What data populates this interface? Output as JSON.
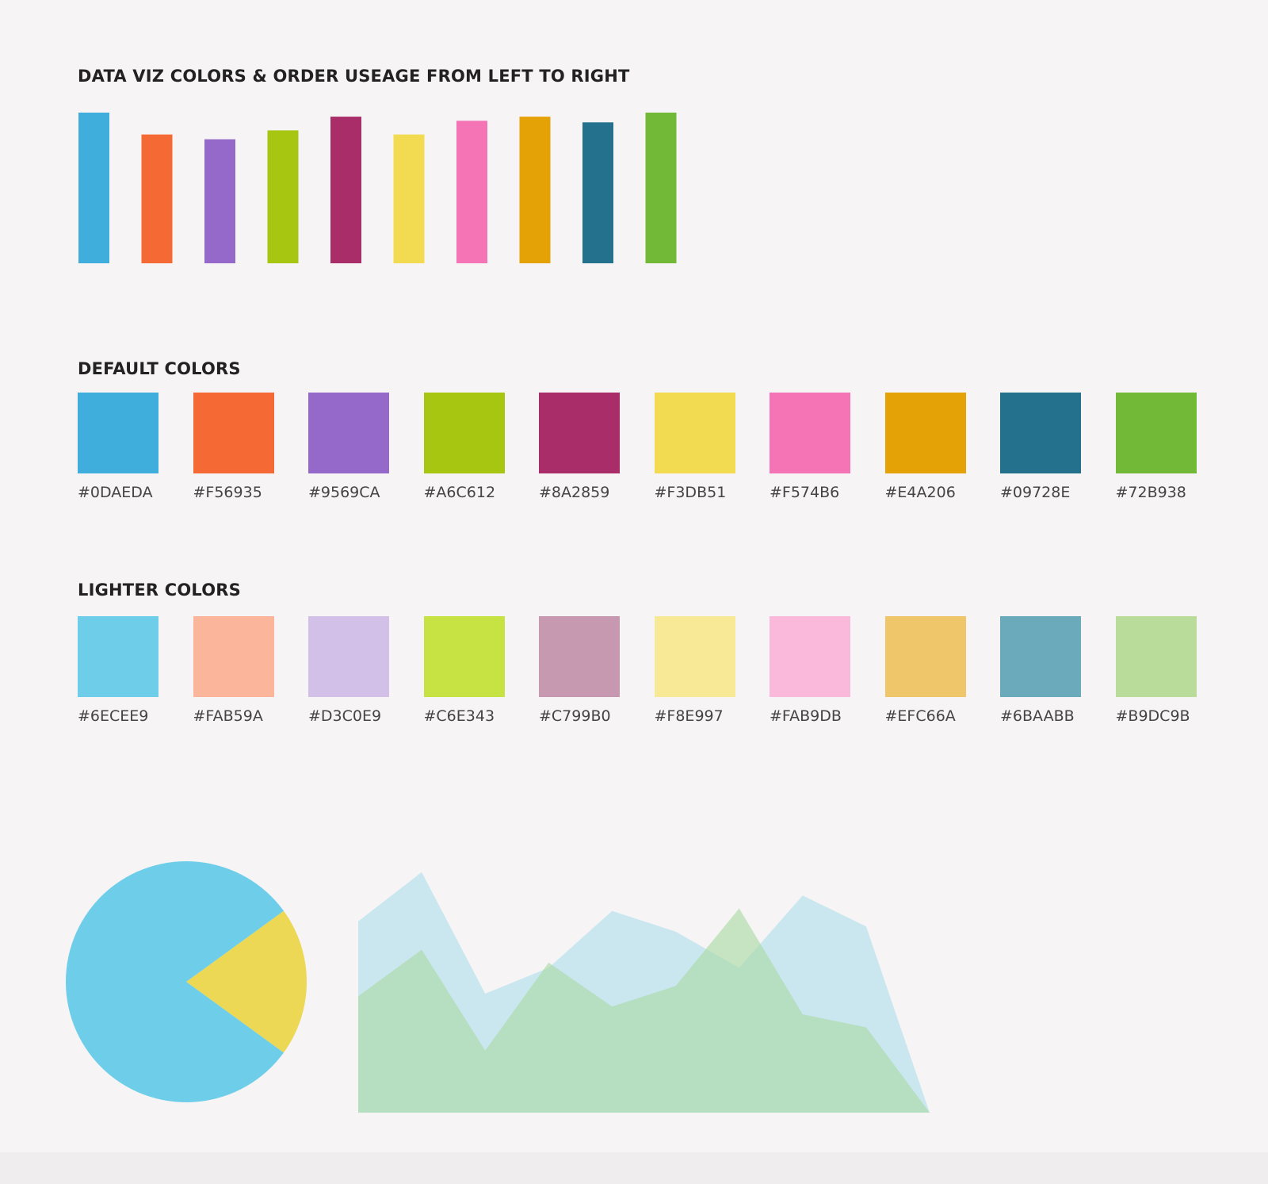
{
  "sections": {
    "order_title": "DATA VIZ COLORS & ORDER USEAGE FROM LEFT TO RIGHT",
    "default_title": "DEFAULT COLORS",
    "lighter_title": "LIGHTER COLORS"
  },
  "default_colors": [
    {
      "label": "#0DAEDA",
      "color": "#40AEDC"
    },
    {
      "label": "#F56935",
      "color": "#F56935"
    },
    {
      "label": "#9569CA",
      "color": "#9569CA"
    },
    {
      "label": "#A6C612",
      "color": "#A6C612"
    },
    {
      "label": "#8A2859",
      "color": "#A82D69"
    },
    {
      "label": "#F3DB51",
      "color": "#F3DB51"
    },
    {
      "label": "#F574B6",
      "color": "#F574B6"
    },
    {
      "label": "#E4A206",
      "color": "#E4A206"
    },
    {
      "label": "#09728E",
      "color": "#24718E"
    },
    {
      "label": "#72B938",
      "color": "#72B938"
    }
  ],
  "lighter_colors": [
    {
      "label": "#6ECEE9",
      "color": "#6ECEE9"
    },
    {
      "label": "#FAB59A",
      "color": "#FAB59A"
    },
    {
      "label": "#D3C0E9",
      "color": "#D3C0E9"
    },
    {
      "label": "#C6E343",
      "color": "#C6E343"
    },
    {
      "label": "#C799B0",
      "color": "#C799B0"
    },
    {
      "label": "#F8E997",
      "color": "#F8E997"
    },
    {
      "label": "#FAB9DB",
      "color": "#FAB9DB"
    },
    {
      "label": "#EFC66A",
      "color": "#EFC66A"
    },
    {
      "label": "#6BAABB",
      "color": "#6BAABB"
    },
    {
      "label": "#B9DC9B",
      "color": "#B9DC9B"
    }
  ],
  "chart_data": [
    {
      "type": "bar",
      "values": [
        100,
        85.5,
        82.3,
        88.2,
        97.3,
        85.5,
        94.6,
        97.3,
        93.5,
        100
      ],
      "colors": [
        "#40AEDC",
        "#F56935",
        "#9569CA",
        "#A6C612",
        "#A82D69",
        "#F3DB51",
        "#F574B6",
        "#E4A206",
        "#24718E",
        "#72B938"
      ],
      "ylim": [
        0,
        100
      ]
    },
    {
      "type": "pie",
      "values": [
        0.8,
        0.2
      ],
      "colors": [
        "#6ECEE9",
        "#ECD854"
      ]
    },
    {
      "type": "area",
      "x": [
        0,
        1,
        2,
        3,
        4,
        5,
        6,
        7,
        8,
        9
      ],
      "ylim": [
        0,
        100
      ],
      "series": [
        {
          "values": [
            74,
            93,
            46,
            56,
            78,
            70,
            56,
            84,
            72,
            0
          ],
          "color": "#6ECEE9",
          "opacity": 0.32
        },
        {
          "values": [
            45,
            63,
            24,
            58,
            41,
            49,
            79,
            38,
            33,
            0
          ],
          "color": "#A9D8A0",
          "opacity": 0.6
        }
      ]
    }
  ]
}
